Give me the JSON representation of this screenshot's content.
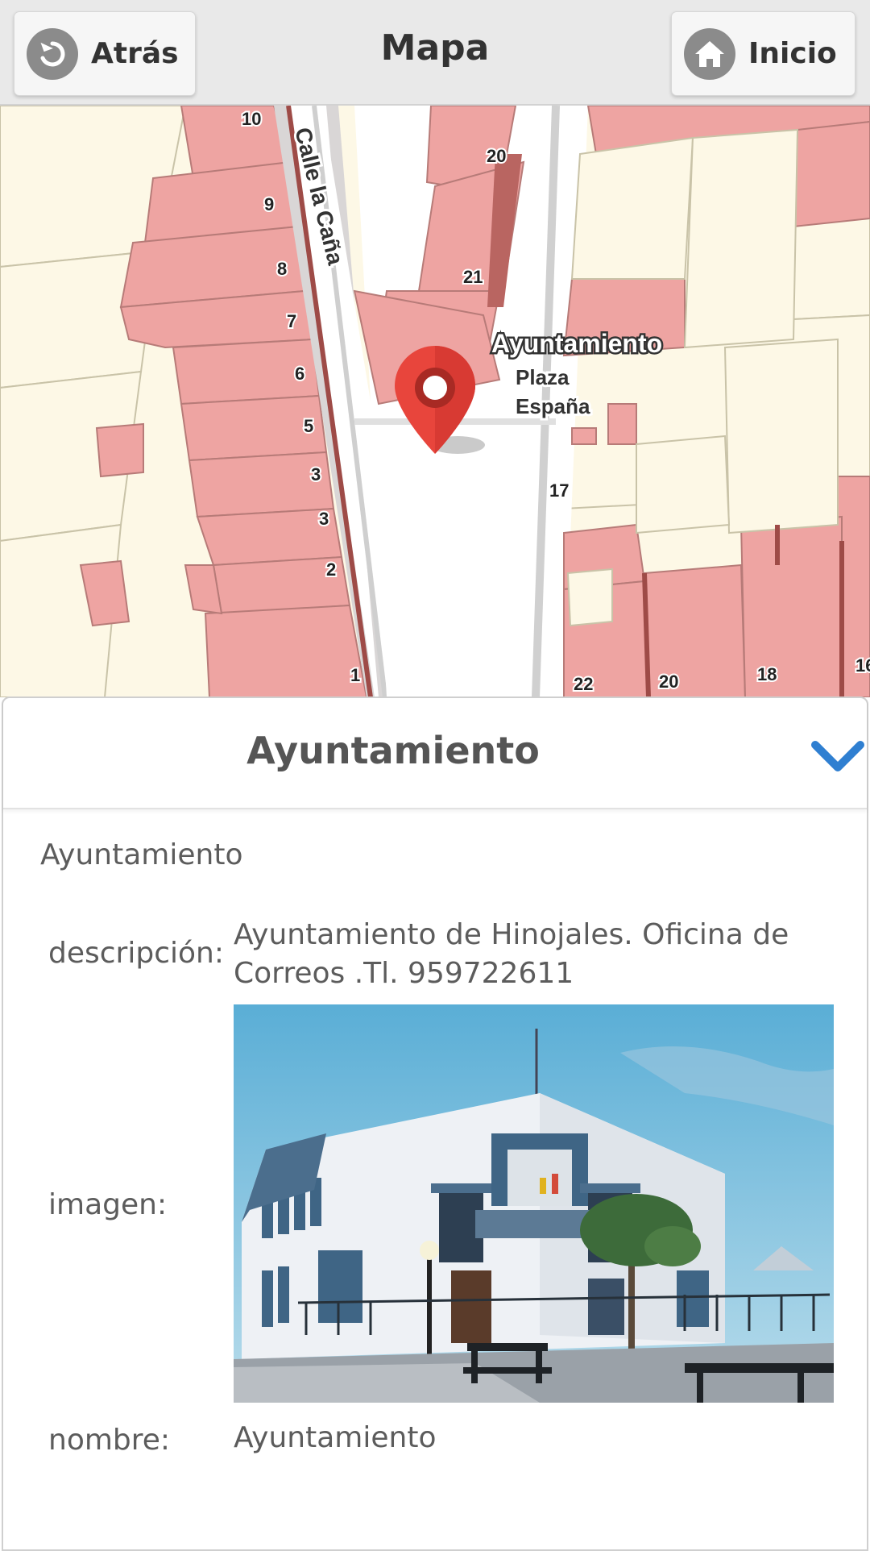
{
  "header": {
    "title": "Mapa",
    "back_label": "Atrás",
    "home_label": "Inicio",
    "back_icon": "back-arrow-icon",
    "home_icon": "home-icon"
  },
  "map": {
    "street_label": "Calle la Caña",
    "marker_label": "Ayuntamiento",
    "place_label_line1": "Plaza",
    "place_label_line2": "España",
    "house_numbers": [
      "10",
      "9",
      "8",
      "7",
      "6",
      "5",
      "3",
      "3",
      "2",
      "1",
      "20",
      "21",
      "17",
      "22",
      "20",
      "18",
      "16"
    ],
    "marker_color": "#e8453c"
  },
  "panel": {
    "title": "Ayuntamiento",
    "collapse_icon": "chevron-down-icon",
    "subtitle": "Ayuntamiento",
    "rows": {
      "descripcion_label": "descripción:",
      "descripcion_line1": "Ayuntamiento de Hinojales. Oficina de",
      "descripcion_line2": "Correos .Tl. 959722611",
      "imagen_label": "imagen:",
      "nombre_label": "nombre:",
      "nombre_value": "Ayuntamiento"
    },
    "accent_color": "#2f7fd1"
  }
}
